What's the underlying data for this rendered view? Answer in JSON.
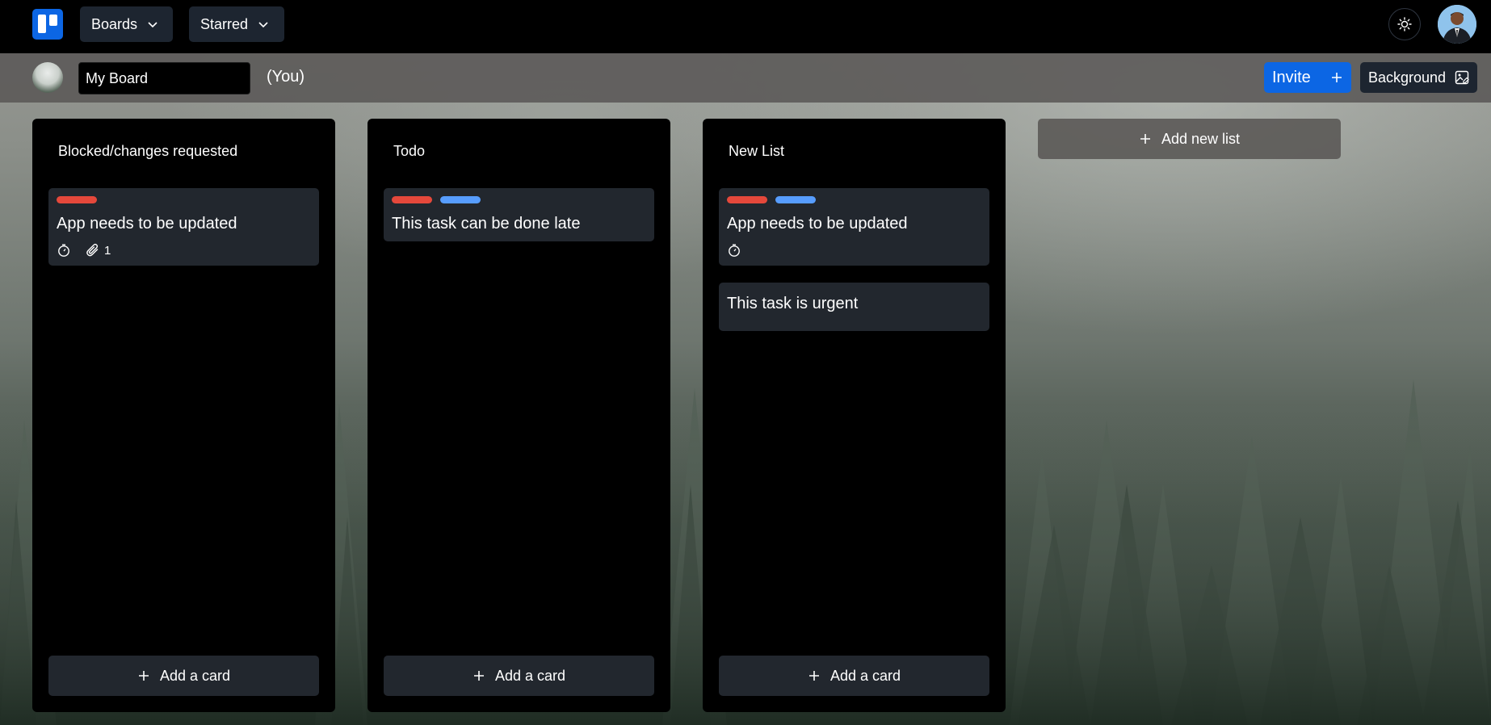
{
  "nav": {
    "boards_label": "Boards",
    "starred_label": "Starred"
  },
  "board": {
    "name": "My Board",
    "owner_label": "(You)",
    "invite_label": "Invite",
    "background_label": "Background"
  },
  "lists": [
    {
      "title": "Blocked/changes requested",
      "cards": [
        {
          "title": "App needs to be updated",
          "labels": [
            "#e5483b"
          ],
          "attachments": "1"
        }
      ],
      "add_label": "Add a card"
    },
    {
      "title": "Todo",
      "cards": [
        {
          "title": "This task can be done late",
          "labels": [
            "#e5483b",
            "#579dff"
          ]
        }
      ],
      "add_label": "Add a card"
    },
    {
      "title": "New List",
      "cards": [
        {
          "title": "App needs to be updated",
          "labels": [
            "#e5483b",
            "#579dff"
          ]
        },
        {
          "title": "This task is urgent"
        }
      ],
      "add_label": "Add a card"
    }
  ],
  "add_list_label": "Add new list",
  "colors": {
    "accent": "#0c66e4",
    "label_red": "#e5483b",
    "label_blue": "#579dff",
    "card_bg": "#22272e"
  }
}
